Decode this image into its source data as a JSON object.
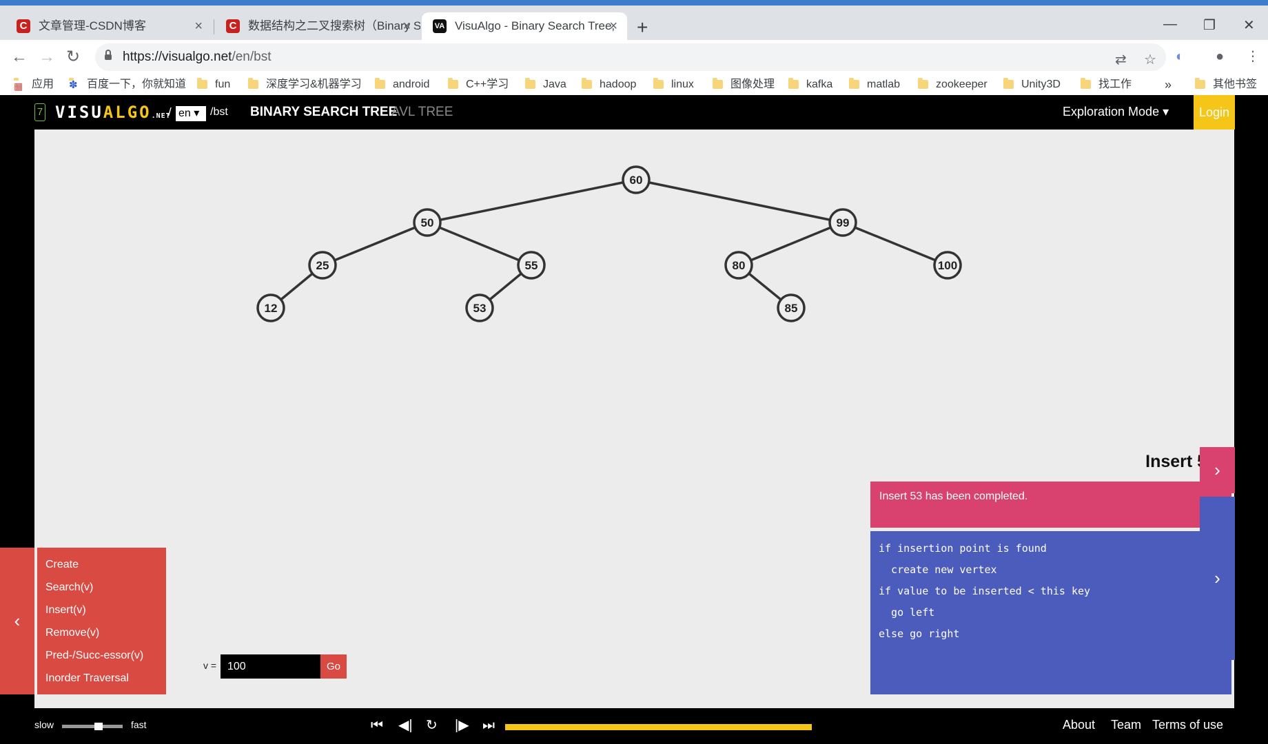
{
  "browser": {
    "tabs": [
      {
        "title": "文章管理-CSDN博客",
        "favicon": "C"
      },
      {
        "title": "数据结构之二叉搜索树（Binary S",
        "favicon": "C"
      },
      {
        "title": "VisuAlgo - Binary Search Tree,",
        "favicon": "VA"
      }
    ],
    "url_host": "https://visualgo.net",
    "url_path": "/en/bst",
    "bookmarks": [
      "应用",
      "百度一下，你就知道",
      "fun",
      "深度学习&机器学习",
      "android",
      "C++学习",
      "Java",
      "hadoop",
      "linux",
      "图像处理",
      "kafka",
      "matlab",
      "zookeeper",
      "Unity3D",
      "找工作"
    ],
    "bookmarks_overflow": "»",
    "other_bookmarks": "其他书签"
  },
  "header": {
    "logo_icon": "7",
    "logo_a": "VISU",
    "logo_b": "ALGO",
    "logo_net": ".NET",
    "slash": "/",
    "lang": "en ▾",
    "path": "/bst",
    "tab_bst": "BINARY SEARCH TREE",
    "tab_avl": "AVL TREE",
    "mode": "Exploration Mode ▾",
    "login": "Login"
  },
  "tree": {
    "nodes": [
      {
        "key": "60",
        "depth": 0,
        "order": 5
      },
      {
        "key": "50",
        "depth": 1,
        "order": 3
      },
      {
        "key": "99",
        "depth": 1,
        "order": 8
      },
      {
        "key": "25",
        "depth": 2,
        "order": 1
      },
      {
        "key": "55",
        "depth": 2,
        "order": 4
      },
      {
        "key": "80",
        "depth": 2,
        "order": 6
      },
      {
        "key": "100",
        "depth": 2,
        "order": 9
      },
      {
        "key": "12",
        "depth": 3,
        "order": 0
      },
      {
        "key": "53",
        "depth": 3,
        "order": 3
      },
      {
        "key": "85",
        "depth": 3,
        "order": 7
      }
    ],
    "edges": [
      [
        "60",
        "50"
      ],
      [
        "60",
        "99"
      ],
      [
        "50",
        "25"
      ],
      [
        "50",
        "55"
      ],
      [
        "25",
        "12"
      ],
      [
        "55",
        "53"
      ],
      [
        "99",
        "80"
      ],
      [
        "99",
        "100"
      ],
      [
        "80",
        "85"
      ]
    ]
  },
  "status": {
    "title": "Insert 53",
    "message": "Insert 53 has been completed.",
    "next": "›"
  },
  "code": {
    "lines": [
      "if insertion point is found",
      "  create new vertex",
      "if value to be inserted < this key",
      "  go left",
      "else go right"
    ],
    "next": "›"
  },
  "actions": {
    "toggle": "‹",
    "items": [
      "Create",
      "Search(v)",
      "Insert(v)",
      "Remove(v)",
      "Pred-/Succ-essor(v)",
      "Inorder Traversal"
    ],
    "v_label": "v =",
    "v_value": "100",
    "go": "Go"
  },
  "footer": {
    "slow": "slow",
    "fast": "fast",
    "speed": 0.6,
    "progress": 1.0,
    "about": "About",
    "team": "Team",
    "terms": "Terms of use"
  },
  "colors": {
    "accent": "#f5c518",
    "status": "#d9416f",
    "code": "#4b5cbd",
    "actions": "#d94a43"
  }
}
